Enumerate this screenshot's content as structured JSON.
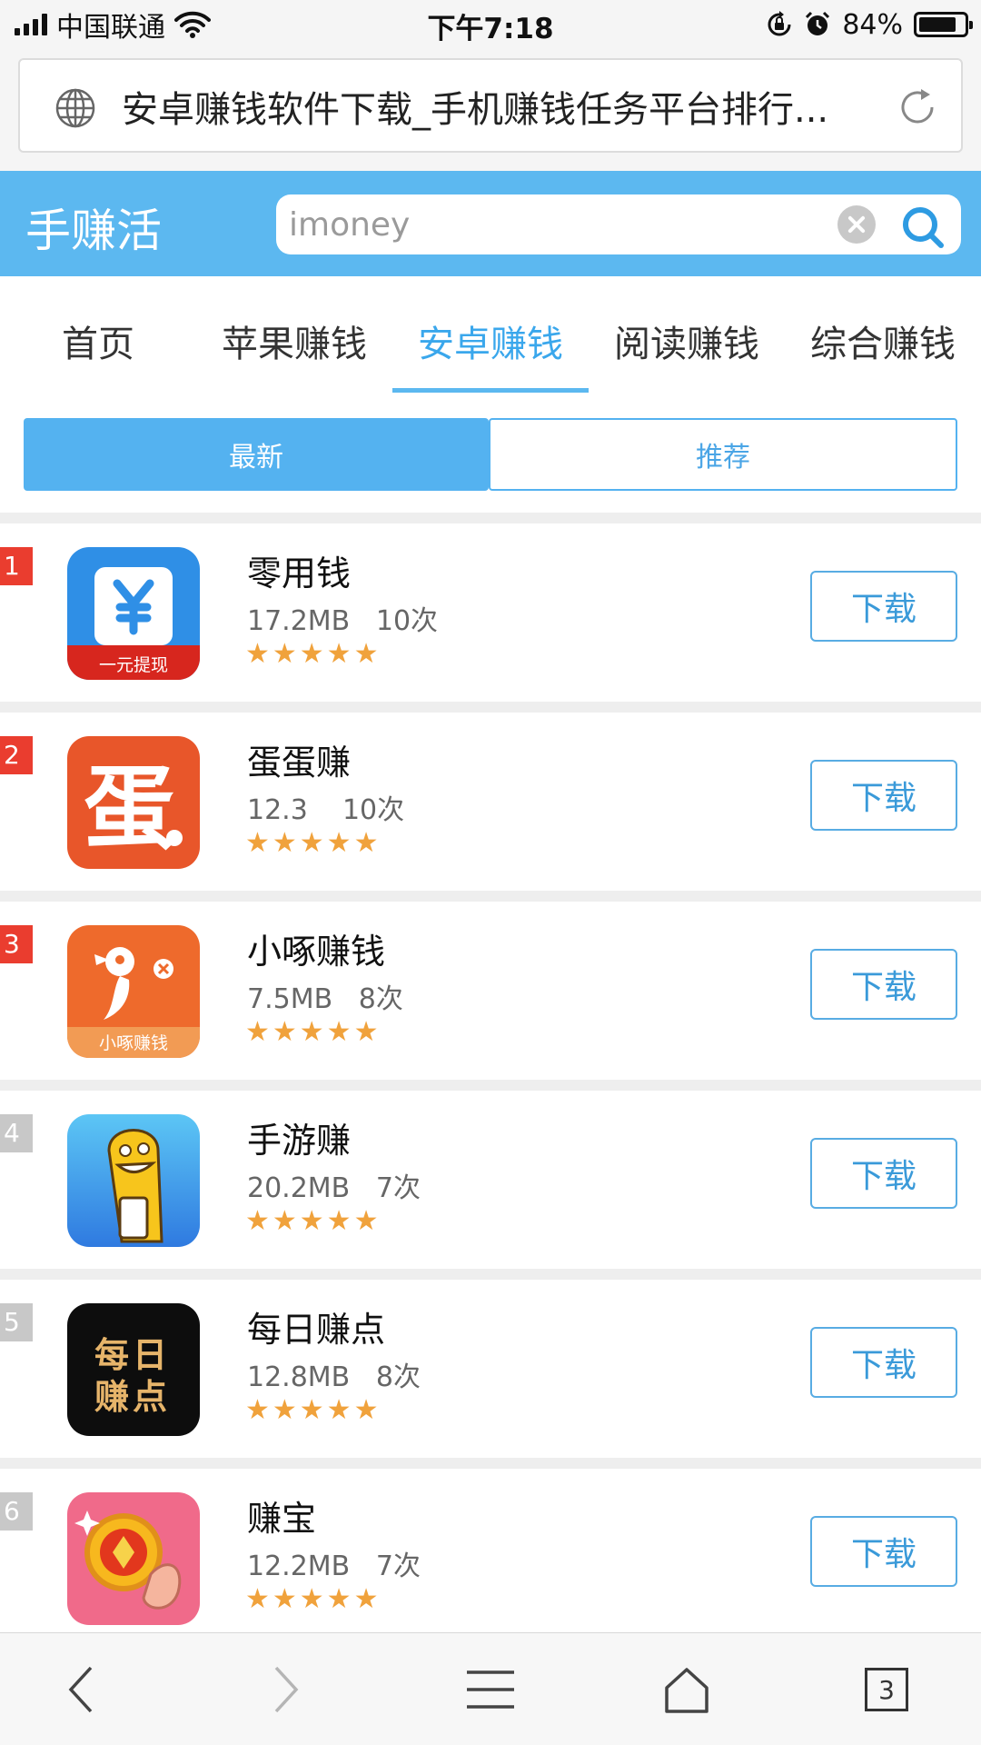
{
  "status_bar": {
    "carrier": "中国联通",
    "time": "下午7:18",
    "battery_percent": "84%",
    "battery_level": 0.84
  },
  "address_bar": {
    "page_title": "安卓赚钱软件下载_手机赚钱任务平台排行..."
  },
  "header": {
    "brand": "手赚活",
    "search_placeholder": "imoney"
  },
  "tabs": [
    {
      "label": "首页",
      "active": false
    },
    {
      "label": "苹果赚钱",
      "active": false
    },
    {
      "label": "安卓赚钱",
      "active": true
    },
    {
      "label": "阅读赚钱",
      "active": false
    },
    {
      "label": "综合赚钱",
      "active": false
    }
  ],
  "sort": {
    "latest_label": "最新",
    "recommend_label": "推荐",
    "selected": "最新"
  },
  "apps": [
    {
      "rank": "1",
      "name": "零用钱",
      "size": "17.2MB",
      "downloads": "10次",
      "rating": 5,
      "stars": "★★★★★",
      "button": "下载",
      "icon_text": "一元提现"
    },
    {
      "rank": "2",
      "name": "蛋蛋赚",
      "size": "12.3",
      "downloads": "10次",
      "rating": 5,
      "stars": "★★★★★",
      "button": "下载",
      "icon_text": "蛋"
    },
    {
      "rank": "3",
      "name": "小啄赚钱",
      "size": "7.5MB",
      "downloads": "8次",
      "rating": 5,
      "stars": "★★★★★",
      "button": "下载",
      "icon_text": "小啄赚钱"
    },
    {
      "rank": "4",
      "name": "手游赚",
      "size": "20.2MB",
      "downloads": "7次",
      "rating": 5,
      "stars": "★★★★★",
      "button": "下载",
      "icon_text": ""
    },
    {
      "rank": "5",
      "name": "每日赚点",
      "size": "12.8MB",
      "downloads": "8次",
      "rating": 5,
      "stars": "★★★★★",
      "button": "下载",
      "icon_text": "每日赚点"
    },
    {
      "rank": "6",
      "name": "赚宝",
      "size": "12.2MB",
      "downloads": "7次",
      "rating": 5,
      "stars": "★★★★★",
      "button": "下载",
      "icon_text": ""
    }
  ],
  "bottom_bar": {
    "tab_count": "3"
  },
  "colors": {
    "accent": "#5cb8f0",
    "rank_hot": "#ea3d2f",
    "rank_cold": "#c8c8c8",
    "star": "#f0a23c"
  }
}
